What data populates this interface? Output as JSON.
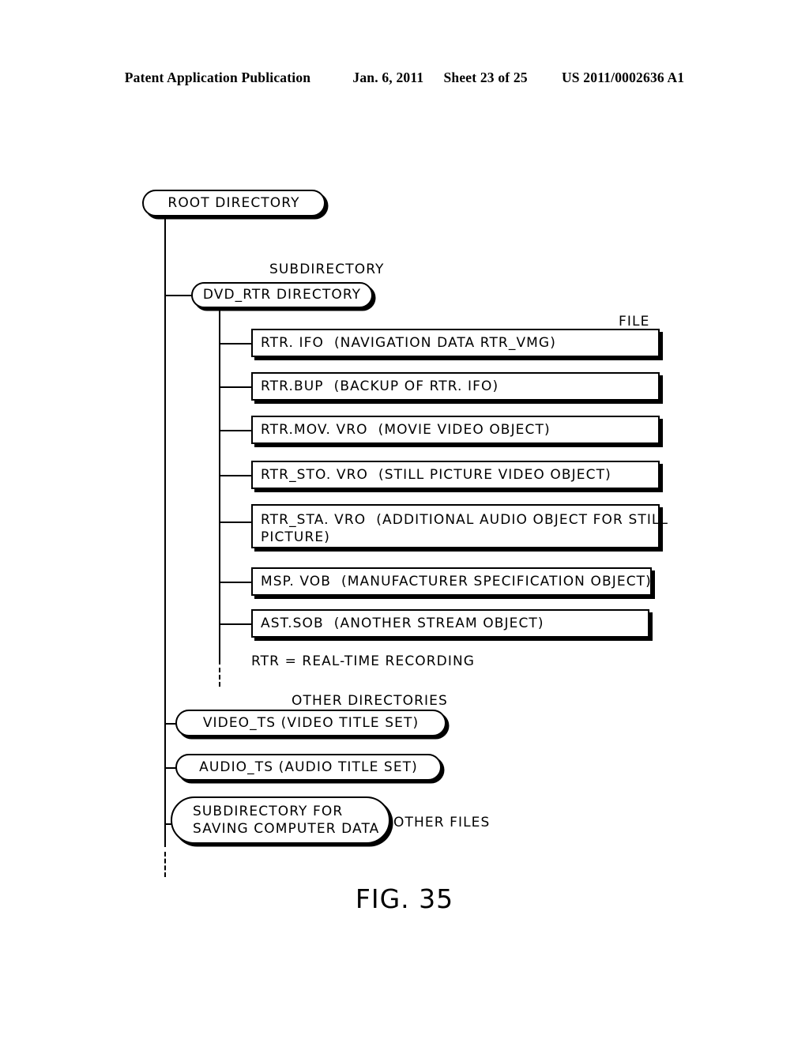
{
  "header": {
    "publication": "Patent Application Publication",
    "date": "Jan. 6, 2011",
    "sheet": "Sheet 23 of 25",
    "patent_number": "US 2011/0002636 A1"
  },
  "figure": {
    "caption": "FIG. 35"
  },
  "diagram": {
    "root": {
      "label": "ROOT DIRECTORY"
    },
    "subdirectory_annotation": "SUBDIRECTORY",
    "file_annotation": "FILE",
    "other_directories_annotation": "OTHER DIRECTORIES",
    "other_files_annotation": "OTHER FILES",
    "dvd_rtr": {
      "label": "DVD_RTR DIRECTORY"
    },
    "files": [
      {
        "label": "RTR. IFO  (NAVIGATION DATA RTR_VMG)"
      },
      {
        "label": "RTR.BUP  (BACKUP OF RTR. IFO)"
      },
      {
        "label": "RTR.MOV. VRO  (MOVIE VIDEO OBJECT)"
      },
      {
        "label": "RTR_STO. VRO  (STILL PICTURE VIDEO OBJECT)"
      },
      {
        "label": "RTR_STA. VRO  (ADDITIONAL AUDIO OBJECT FOR STILL\nPICTURE)"
      },
      {
        "label": "MSP. VOB  (MANUFACTURER SPECIFICATION OBJECT)"
      },
      {
        "label": "AST.SOB  (ANOTHER STREAM OBJECT)"
      }
    ],
    "note": "RTR = REAL-TIME RECORDING",
    "other_directories": [
      {
        "label": "VIDEO_TS (VIDEO TITLE SET)"
      },
      {
        "label": "AUDIO_TS (AUDIO TITLE SET)"
      }
    ],
    "computer_data_dir": {
      "label": "SUBDIRECTORY FOR\nSAVING COMPUTER DATA"
    }
  }
}
